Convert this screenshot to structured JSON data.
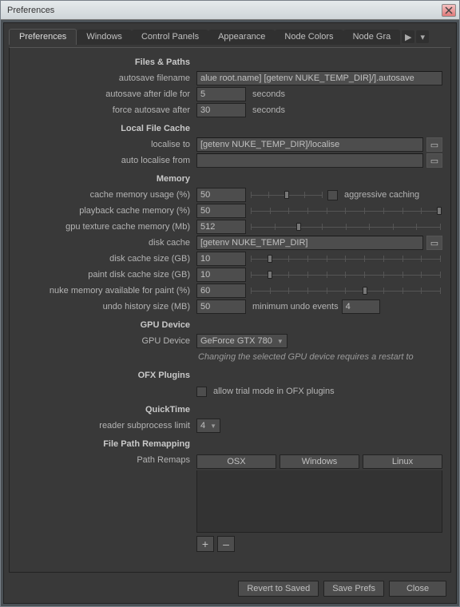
{
  "window": {
    "title": "Preferences"
  },
  "tabs": [
    "Preferences",
    "Windows",
    "Control Panels",
    "Appearance",
    "Node Colors",
    "Node Gra"
  ],
  "sections": {
    "files_paths": "Files & Paths",
    "local_cache": "Local File Cache",
    "memory": "Memory",
    "gpu": "GPU Device",
    "ofx": "OFX Plugins",
    "quicktime": "QuickTime",
    "remap": "File Path Remapping"
  },
  "labels": {
    "autosave_filename": "autosave filename",
    "autosave_idle": "autosave after idle for",
    "force_autosave": "force autosave after",
    "seconds": "seconds",
    "localise_to": "localise to",
    "auto_localise_from": "auto localise from",
    "cache_mem": "cache memory usage (%)",
    "playback_cache": "playback cache memory (%)",
    "gpu_tex": "gpu texture cache memory (Mb)",
    "disk_cache": "disk cache",
    "disk_cache_size": "disk cache size (GB)",
    "paint_disk_cache": "paint disk cache size (GB)",
    "nuke_mem_paint": "nuke memory available for paint (%)",
    "undo_history": "undo history size (MB)",
    "min_undo": "minimum undo events",
    "aggressive": "aggressive caching",
    "gpu_device": "GPU Device",
    "gpu_hint": "Changing the selected GPU device requires a restart to",
    "allow_trial": "allow trial mode in OFX plugins",
    "reader_sub": "reader subprocess limit",
    "path_remaps": "Path Remaps",
    "osx": "OSX",
    "windows": "Windows",
    "linux": "Linux"
  },
  "values": {
    "autosave_filename": "alue root.name] [getenv NUKE_TEMP_DIR]/].autosave",
    "autosave_idle": "5",
    "force_autosave": "30",
    "localise_to": "[getenv NUKE_TEMP_DIR]/localise",
    "auto_localise_from": "",
    "cache_mem": "50",
    "playback_cache": "50",
    "gpu_tex": "512",
    "disk_cache": "[getenv NUKE_TEMP_DIR]",
    "disk_cache_size": "10",
    "paint_disk_cache": "10",
    "nuke_mem_paint": "60",
    "undo_history": "50",
    "min_undo": "4",
    "gpu_device": "GeForce GTX 780",
    "reader_sub": "4"
  },
  "sliders": {
    "cache_mem": 50,
    "playback_cache": 99,
    "gpu_tex": 25,
    "disk_cache_size": 10,
    "paint_disk_cache": 10,
    "nuke_mem_paint": 60
  },
  "buttons": {
    "revert": "Revert to Saved",
    "save": "Save Prefs",
    "close": "Close",
    "add": "+",
    "remove": "–"
  }
}
